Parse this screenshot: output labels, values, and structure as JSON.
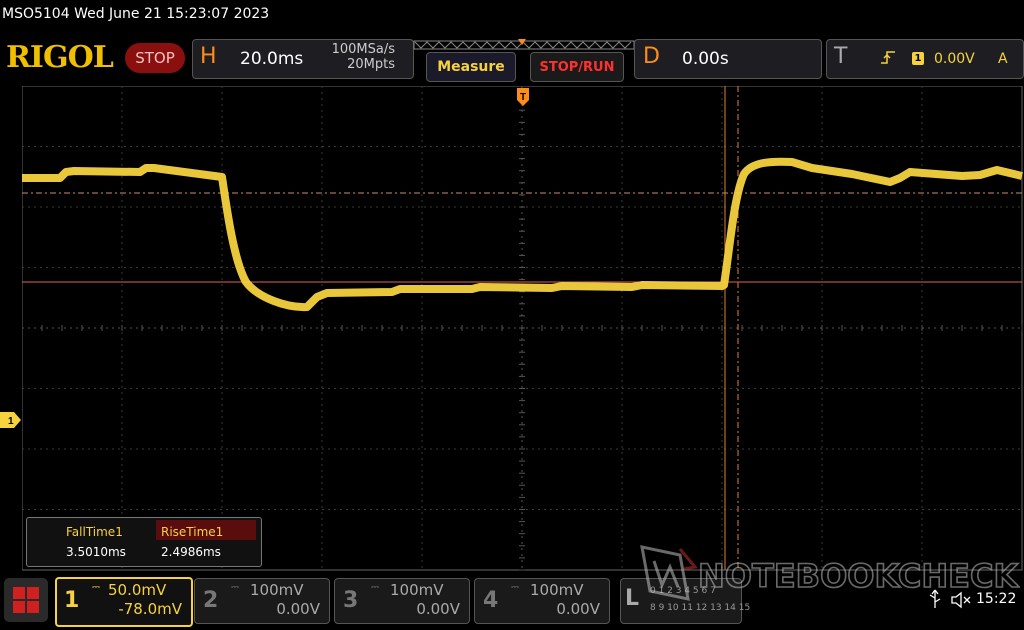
{
  "header": {
    "title_line": "MSO5104  Wed June 21 15:23:07 2023",
    "logo": "RIGOL",
    "stop_label": "STOP"
  },
  "horizontal": {
    "letter": "H",
    "timebase": "20.0ms",
    "sample_rate": "100MSa/s",
    "memory_depth": "20Mpts"
  },
  "toolbar": {
    "measure_label": "Measure",
    "stoprun_label": "STOP/RUN"
  },
  "delay": {
    "letter": "D",
    "value": "0.00s"
  },
  "trigger": {
    "letter": "T",
    "edge_icon": "rising-edge-icon",
    "channel": "1",
    "level": "0.00V",
    "mode": "A"
  },
  "channel_marker": "1",
  "measurements": {
    "fall_label": "FallTime1",
    "fall_value": "3.5010ms",
    "rise_label": "RiseTime1",
    "rise_value": "2.4986ms"
  },
  "channels": [
    {
      "num": "1",
      "scale": "50.0mV",
      "offset": "-78.0mV",
      "color": "#f6d23e"
    },
    {
      "num": "2",
      "scale": "100mV",
      "offset": "0.00V",
      "color": "#777777"
    },
    {
      "num": "3",
      "scale": "100mV",
      "offset": "0.00V",
      "color": "#777777"
    },
    {
      "num": "4",
      "scale": "100mV",
      "offset": "0.00V",
      "color": "#777777"
    }
  ],
  "logic": {
    "letter": "L",
    "row1": "0 1 2 3 4 5 6 7",
    "row2": "8 9 10 11 12 13 14 15"
  },
  "status": {
    "clock": "15:22",
    "usb_icon": "usb-icon",
    "speaker_icon": "speaker-muted-icon"
  },
  "watermark": "NOTEBOOKCHECK",
  "colors": {
    "trace": "#f6d23e",
    "accent_orange": "#ff8c1a",
    "cursor_red": "#e06060"
  }
}
